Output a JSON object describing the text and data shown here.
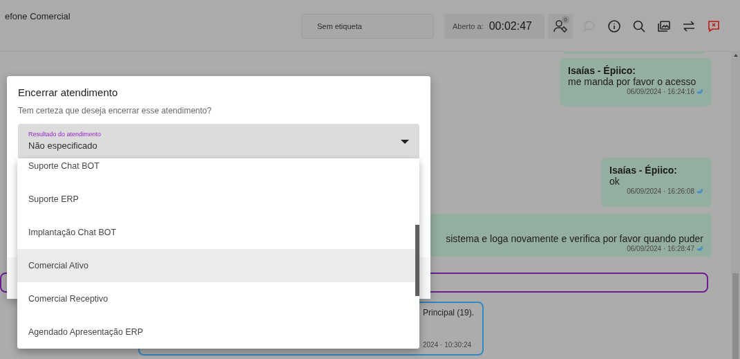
{
  "header": {
    "title": "efone Comercial",
    "tag": "Sem etiqueta",
    "timer_label": "Aberto a:",
    "timer": "00:02:47",
    "badge": "0",
    "icons": [
      {
        "kind": "contacts",
        "disabled": false
      },
      {
        "kind": "chat",
        "disabled": true
      },
      {
        "kind": "info",
        "disabled": false
      },
      {
        "kind": "search",
        "disabled": false
      },
      {
        "kind": "gallery",
        "disabled": false
      },
      {
        "kind": "transfer",
        "disabled": false
      },
      {
        "kind": "close",
        "disabled": false
      }
    ]
  },
  "messages": [
    {
      "kind": "partial"
    },
    {
      "kind": "bubble",
      "author": "Isaías - Épiico:",
      "text": "me manda por favor o acesso",
      "time": "06/09/2024 · 16:24:16",
      "read": true
    },
    {
      "kind": "bubble",
      "author": "Isaías - Épiico:",
      "text": "ok",
      "time": "06/09/2024 · 16:26:08",
      "read": true
    },
    {
      "kind": "wide",
      "text": "sistema e loga novamente e verifica por favor quando puder",
      "time": "06/09/2024 · 16:28:47",
      "read": true
    },
    {
      "kind": "outline"
    },
    {
      "kind": "system",
      "text": "Principal (19).",
      "time": "2024 · 10:30:24"
    }
  ],
  "dialog": {
    "title": "Encerrar atendimento",
    "message": "Tem certeza que deseja encerrar esse atendimento?",
    "select": {
      "label": "Resultado do atendimento",
      "value": "Não especificado"
    },
    "options": [
      {
        "label": "Suporte Chat BOT",
        "selected": false
      },
      {
        "label": "Suporte ERP",
        "selected": false
      },
      {
        "label": "Implantação Chat BOT",
        "selected": false
      },
      {
        "label": "Comercial Ativo",
        "selected": true
      },
      {
        "label": "Comercial Receptivo",
        "selected": false
      },
      {
        "label": "Agendado Apresentação ERP",
        "selected": false
      }
    ]
  }
}
